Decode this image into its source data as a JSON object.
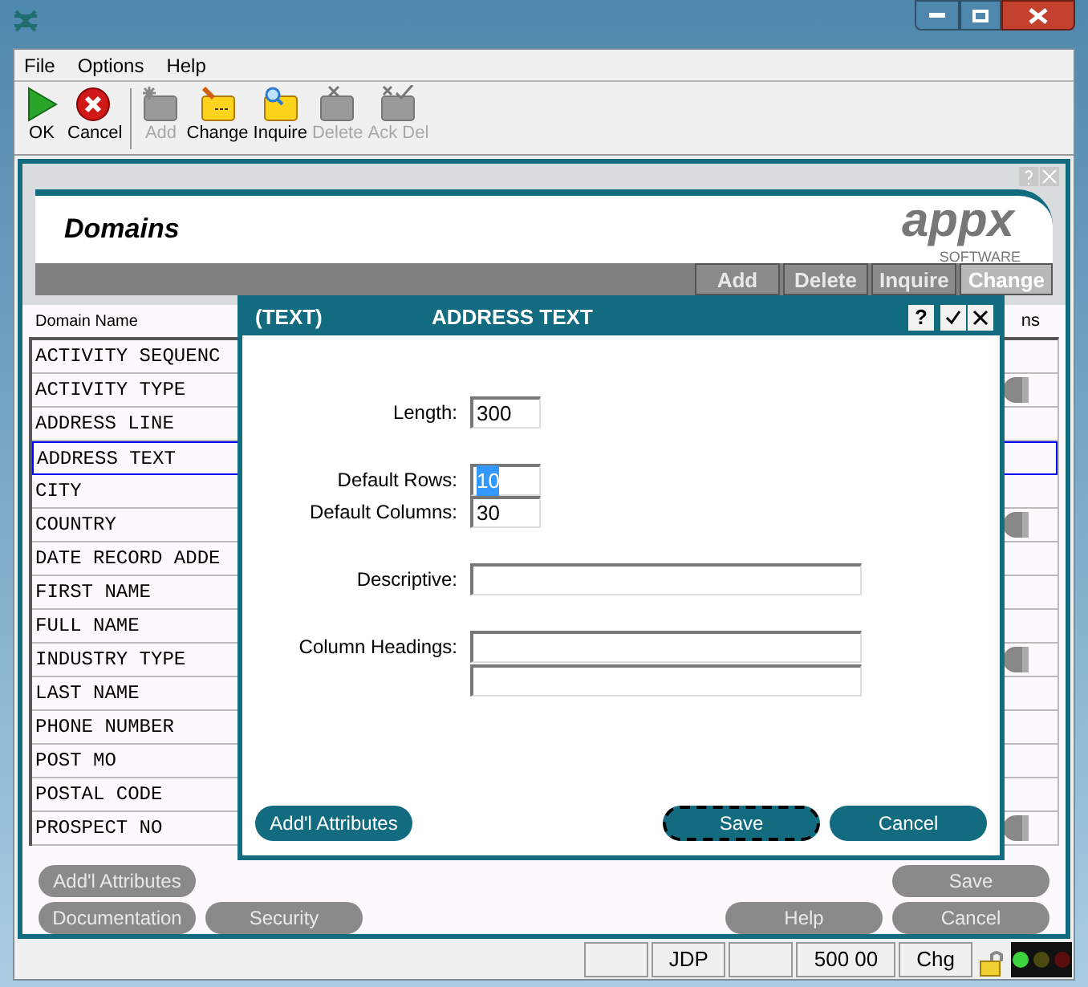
{
  "menu": [
    {
      "label": "File"
    },
    {
      "label": "Options"
    },
    {
      "label": "Help"
    }
  ],
  "toolbar": [
    {
      "label": "OK",
      "disabled": false
    },
    {
      "label": "Cancel",
      "disabled": false
    },
    {
      "label": "Add",
      "disabled": true
    },
    {
      "label": "Change",
      "disabled": false
    },
    {
      "label": "Inquire",
      "disabled": false
    },
    {
      "label": "Delete",
      "disabled": true
    },
    {
      "label": "Ack Del",
      "disabled": true
    }
  ],
  "screen": {
    "title": "Domains",
    "logo": "appx",
    "logo_sub": "SOFTWARE",
    "actions": [
      {
        "label": "Add",
        "selected": false
      },
      {
        "label": "Delete",
        "selected": false
      },
      {
        "label": "Inquire",
        "selected": false
      },
      {
        "label": "Change",
        "selected": true
      }
    ]
  },
  "table": {
    "columns": [
      "Domain Name",
      "ns"
    ],
    "rows": [
      {
        "name": "ACTIVITY SEQUENC",
        "selected": false,
        "flag": false
      },
      {
        "name": "ACTIVITY TYPE",
        "selected": false,
        "flag": true
      },
      {
        "name": "ADDRESS LINE",
        "selected": false,
        "flag": false
      },
      {
        "name": "ADDRESS TEXT",
        "selected": true,
        "flag": false
      },
      {
        "name": "CITY",
        "selected": false,
        "flag": false
      },
      {
        "name": "COUNTRY",
        "selected": false,
        "flag": true
      },
      {
        "name": "DATE RECORD ADDE",
        "selected": false,
        "flag": false
      },
      {
        "name": "FIRST NAME",
        "selected": false,
        "flag": false
      },
      {
        "name": "FULL NAME",
        "selected": false,
        "flag": false
      },
      {
        "name": "INDUSTRY TYPE",
        "selected": false,
        "flag": true
      },
      {
        "name": "LAST NAME",
        "selected": false,
        "flag": false
      },
      {
        "name": "PHONE NUMBER",
        "selected": false,
        "flag": false
      },
      {
        "name": "POST MO",
        "selected": false,
        "flag": false
      },
      {
        "name": "POSTAL CODE",
        "selected": false,
        "flag": false
      },
      {
        "name": "PROSPECT NO",
        "selected": false,
        "flag": true
      }
    ]
  },
  "buttons_left": [
    [
      "Add'l Attributes"
    ],
    [
      "Documentation",
      "Security"
    ]
  ],
  "buttons_right": [
    [
      "Save"
    ],
    [
      "Help",
      "Cancel"
    ]
  ],
  "status_bar": [
    {
      "kind": "blank"
    },
    {
      "kind": "text",
      "text": "JDP"
    },
    {
      "kind": "blank"
    },
    {
      "kind": "text",
      "text": "500 00"
    },
    {
      "kind": "text",
      "text": "Chg"
    }
  ],
  "dialog": {
    "type": "(TEXT)",
    "title": "ADDRESS TEXT",
    "help": "?",
    "fields": [
      {
        "label": "Length:",
        "value": "300",
        "kind": "short",
        "highlighted": false
      },
      {
        "kind": "gap"
      },
      {
        "label": "Default Rows:",
        "value": "10",
        "kind": "short",
        "highlighted": true
      },
      {
        "label": "Default Columns:",
        "value": "30",
        "kind": "short",
        "highlighted": false
      },
      {
        "kind": "gap"
      },
      {
        "label": "Descriptive:",
        "kind": "long",
        "highlighted": false
      },
      {
        "kind": "gap"
      },
      {
        "label": "Column Headings:",
        "kind": "double",
        "highlighted": false
      }
    ],
    "buttons": [
      {
        "label": "Add'l Attributes",
        "focused": false
      },
      {
        "label": "Save",
        "focused": true
      },
      {
        "label": "Cancel",
        "focused": false
      }
    ]
  }
}
